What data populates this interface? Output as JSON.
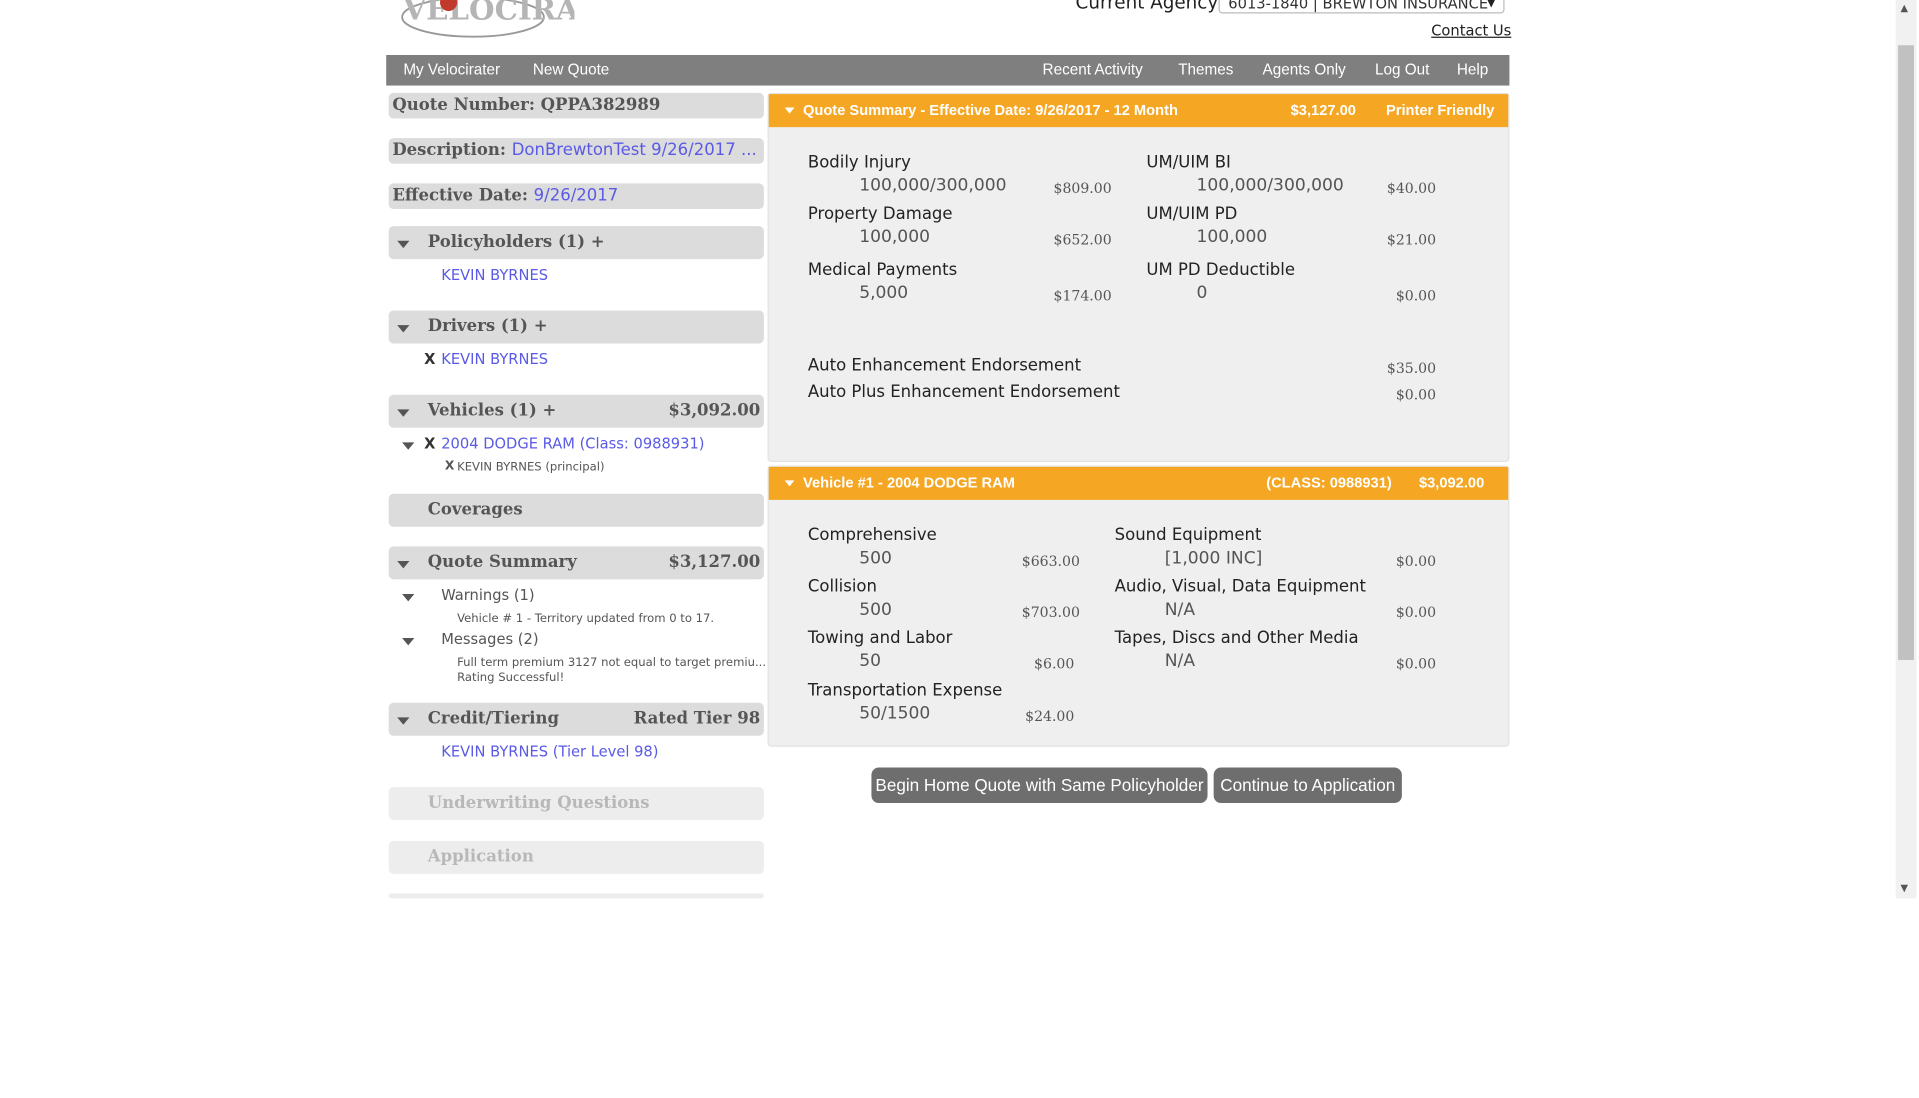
{
  "header": {
    "logo_text": "VELOCIRATER",
    "agency_label": "Current Agency:",
    "agency_value": "6013-1840 | BREWTON INSURANCE",
    "contact_link": "Contact Us"
  },
  "nav": {
    "left": [
      "My Velocirater",
      "New Quote"
    ],
    "right": [
      "Recent Activity",
      "Themes",
      "Agents Only",
      "Log Out",
      "Help"
    ]
  },
  "sidebar": {
    "quote_number_label": "Quote Number:",
    "quote_number": "QPPA382989",
    "description_label": "Description:",
    "description": "DonBrewtonTest 9/26/2017 ...",
    "effective_date_label": "Effective Date:",
    "effective_date": "9/26/2017",
    "policyholders_title": "Policyholders (1) +",
    "policyholder": "KEVIN BYRNES",
    "drivers_title": "Drivers (1) +",
    "driver_remove": "X",
    "driver": "KEVIN BYRNES",
    "vehicles_title": "Vehicles (1) +",
    "vehicles_amount": "$3,092.00",
    "vehicle_remove": "X",
    "vehicle": "2004 DODGE RAM (Class: 0988931)",
    "vehicle_driver_remove": "X",
    "vehicle_driver": "KEVIN BYRNES (principal)",
    "coverages_title": "Coverages",
    "quote_summary_title": "Quote Summary",
    "quote_summary_amount": "$3,127.00",
    "warnings_title": "Warnings (1)",
    "warning_text": "Vehicle # 1 - Territory updated from 0 to 17.",
    "messages_title": "Messages (2)",
    "message_1": "Full term premium 3127 not equal to target premiu...",
    "message_2": "Rating Successful!",
    "credit_title": "Credit/Tiering",
    "credit_amount": "Rated Tier 98",
    "credit_item": "KEVIN BYRNES (Tier Level 98)",
    "underwriting_title": "Underwriting Questions",
    "application_title": "Application"
  },
  "summary_panel": {
    "title": "Quote Summary - Effective Date: 9/26/2017 - 12 Month",
    "total": "$3,127.00",
    "printer": "Printer Friendly",
    "left": [
      {
        "name": "Bodily Injury",
        "value": "100,000/300,000",
        "premium": "$809.00"
      },
      {
        "name": "Property Damage",
        "value": "100,000",
        "premium": "$652.00"
      },
      {
        "name": "Medical Payments",
        "value": "5,000",
        "premium": "$174.00"
      }
    ],
    "right": [
      {
        "name": "UM/UIM BI",
        "value": "100,000/300,000",
        "premium": "$40.00"
      },
      {
        "name": "UM/UIM PD",
        "value": "100,000",
        "premium": "$21.00"
      },
      {
        "name": "UM PD Deductible",
        "value": "0",
        "premium": "$0.00"
      }
    ],
    "endorsements": [
      {
        "name": "Auto Enhancement Endorsement",
        "premium": "$35.00"
      },
      {
        "name": "Auto Plus Enhancement Endorsement",
        "premium": "$0.00"
      }
    ]
  },
  "vehicle_panel": {
    "title": "Vehicle #1 - 2004 DODGE RAM",
    "class": "(CLASS: 0988931)",
    "total": "$3,092.00",
    "left": [
      {
        "name": "Comprehensive",
        "value": "500",
        "premium": "$663.00"
      },
      {
        "name": "Collision",
        "value": "500",
        "premium": "$703.00"
      },
      {
        "name": "Towing and Labor",
        "value": "50",
        "premium": "$6.00"
      },
      {
        "name": "Transportation Expense",
        "value": "50/1500",
        "premium": "$24.00"
      }
    ],
    "right": [
      {
        "name": "Sound Equipment",
        "value": "[1,000 INC]",
        "premium": "$0.00"
      },
      {
        "name": "Audio, Visual, Data Equipment",
        "value": "N/A",
        "premium": "$0.00"
      },
      {
        "name": "Tapes, Discs and Other Media",
        "value": "N/A",
        "premium": "$0.00"
      }
    ]
  },
  "buttons": {
    "home_quote": "Begin Home Quote with Same Policyholder",
    "continue": "Continue to Application"
  },
  "colors": {
    "accent": "#f5a623",
    "nav": "#7f7f7f",
    "link": "#5a5ae6",
    "button": "#6e6e6e"
  }
}
